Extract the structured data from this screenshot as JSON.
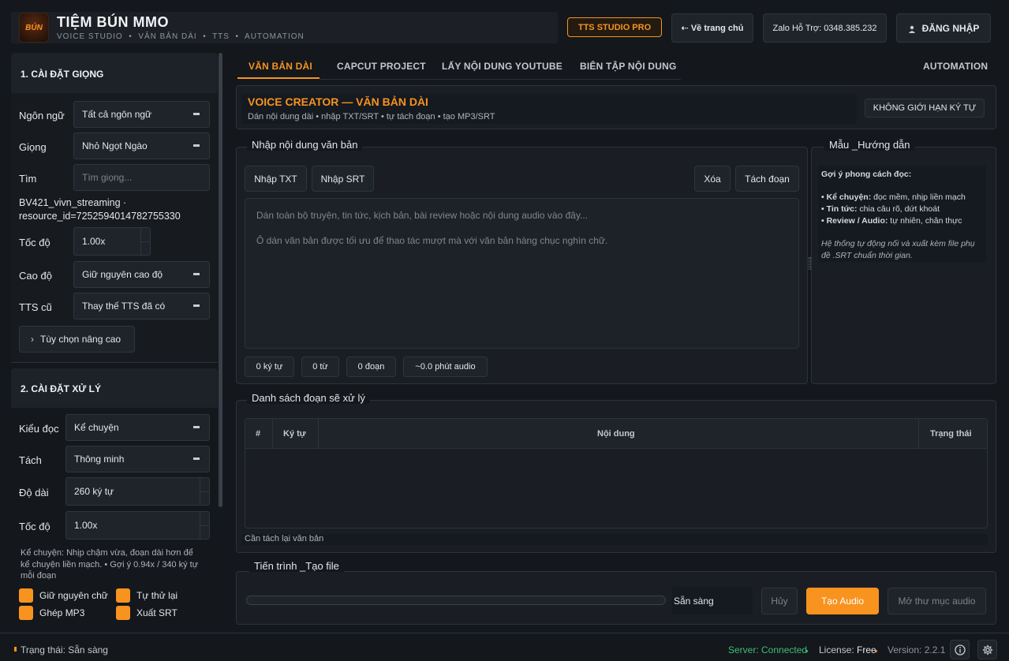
{
  "header": {
    "logo_text": "BÚN",
    "app_title": "TIỆM BÚN MMO",
    "subtitle": "VOICE STUDIO  •  VĂN BẢN DÀI  •  TTS  •  AUTOMATION",
    "badge": "TTS STUDIO PRO",
    "home_button": "⇠ Về trang chủ",
    "zalo": "Zalo Hỗ Trợ: 0348.385.232",
    "login": "ĐĂNG NHẬP"
  },
  "voice_settings": {
    "title": "1. CÀI ĐẶT GIỌNG",
    "language_label": "Ngôn ngữ",
    "language_value": "Tất cả ngôn ngữ",
    "voice_label": "Giọng",
    "voice_value": "Nhỏ Ngọt Ngào",
    "search_label": "Tìm",
    "search_placeholder": "Tìm giọng...",
    "voice_id_line1": "BV421_vivn_streaming ·",
    "voice_id_line2": "resource_id=7252594014782755330",
    "speed_label": "Tốc độ",
    "speed_value": "1.00x",
    "pitch_label": "Cao độ",
    "pitch_value": "Giữ nguyên cao độ",
    "old_tts_label": "TTS cũ",
    "old_tts_value": "Thay thế TTS đã có",
    "advanced": "Tùy chọn nâng cao"
  },
  "process_settings": {
    "title": "2. CÀI ĐẶT XỬ LÝ",
    "style_label": "Kiểu đọc",
    "style_value": "Kể chuyện",
    "split_label": "Tách",
    "split_value": "Thông minh",
    "length_label": "Độ dài",
    "length_value": "260 ký tự",
    "speed_label": "Tốc độ",
    "speed_value": "1.00x",
    "hint_line1": "Kể chuyện: Nhịp chậm vừa, đoạn dài hơn để",
    "hint_line2": "kể chuyện liền mạch.  • Gợi ý 0.94x / 340 ký tự",
    "hint_line3": "mỗi đoạn",
    "checkboxes": [
      "Giữ nguyên chữ",
      "Tự thử lại",
      "Ghép MP3",
      "Xuất SRT"
    ]
  },
  "tabs": [
    "VĂN BẢN DÀI",
    "CAPCUT PROJECT",
    "LẤY NỘI DUNG YOUTUBE",
    "BIÊN TẬP NỘI DUNG",
    "AUTOMATION"
  ],
  "creator": {
    "title": "VOICE CREATOR — VĂN BẢN DÀI",
    "subtitle": "Dán nội dung dài • nhập TXT/SRT • tự tách đoạn • tạo MP3/SRT",
    "limit_button": "KHÔNG GIỚI HẠN KÝ TỰ"
  },
  "input_panel": {
    "legend": "Nhập nội dung văn bản",
    "import_txt": "Nhập TXT",
    "import_srt": "Nhập SRT",
    "clear": "Xóa",
    "split": "Tách đoạn",
    "placeholder_line1": "Dán toàn bộ truyện, tin tức, kịch bản, bài review hoặc nội dung audio vào đây...",
    "placeholder_line2": "Ô dán văn bản được tối ưu để thao tác mượt mà với văn bản hàng chục nghìn chữ.",
    "counters": [
      "0 ký tự",
      "0 từ",
      "0 đoạn",
      "~0.0 phút audio"
    ]
  },
  "guide_panel": {
    "legend": "Mẫu _Hướng dẫn",
    "heading": "Gợi ý phong cách đọc:",
    "items": [
      {
        "key": "• Kể chuyện:",
        "val": " đọc mềm, nhịp liền mạch"
      },
      {
        "key": "• Tin tức:",
        "val": " chia câu rõ, dứt khoát"
      },
      {
        "key": "• Review / Audio:",
        "val": " tự nhiên, chân thực"
      }
    ],
    "note_line1": "Hệ thống tự động nối và xuất kèm file phụ",
    "note_line2": "đề .SRT chuẩn thời gian."
  },
  "segments": {
    "legend": "Danh sách đoạn sẽ xử lý",
    "columns": [
      "#",
      "Ký tự",
      "Nội dung",
      "Trạng thái"
    ],
    "status_text": "Cần tách lại văn bản"
  },
  "progress": {
    "legend": "Tiến trình _Tạo file",
    "value": 0,
    "status": "Sẵn sàng",
    "cancel": "Hủy",
    "create": "Tạo Audio",
    "open_folder": "Mở thư mục audio"
  },
  "statusbar": {
    "state": "Trạng thái: Sẵn sàng",
    "server": "Server: Connected",
    "license_label": "License: ",
    "license_value": "Free",
    "version": "Version: 2.2.1"
  },
  "colors": {
    "accent": "#f7931e",
    "background": "#14171c",
    "connected": "#3cbf7a"
  }
}
